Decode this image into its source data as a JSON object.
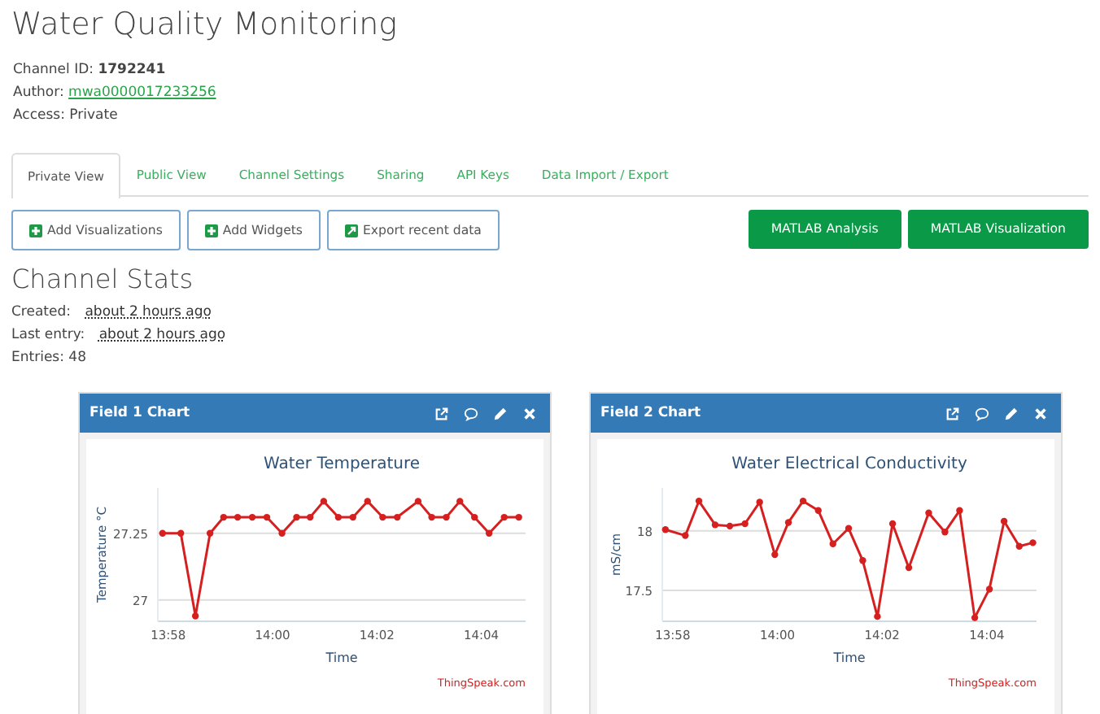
{
  "title": "Water Quality Monitoring",
  "channel_info": [
    {
      "label": "Channel ID:",
      "value": "1792241",
      "kind": "bold"
    },
    {
      "label": "Author:",
      "value": "mwa0000017233256",
      "kind": "link"
    },
    {
      "label": "Access:",
      "value": "Private",
      "kind": "plain"
    }
  ],
  "tabs": [
    {
      "label": "Private View",
      "selected": true
    },
    {
      "label": "Public View",
      "selected": false
    },
    {
      "label": "Channel Settings",
      "selected": false
    },
    {
      "label": "Sharing",
      "selected": false
    },
    {
      "label": "API Keys",
      "selected": false
    },
    {
      "label": "Data Import / Export",
      "selected": false
    }
  ],
  "action_buttons": [
    {
      "label": "Add Visualizations",
      "kind": "plus"
    },
    {
      "label": "Add Widgets",
      "kind": "plus"
    },
    {
      "label": "Export recent data",
      "kind": "export"
    }
  ],
  "matlab_buttons": [
    "MATLAB Analysis",
    "MATLAB Visualization"
  ],
  "stats": {
    "heading": "Channel Stats",
    "items": [
      {
        "label": "Created:",
        "value": "about 2 hours ago",
        "kind": "time"
      },
      {
        "label": "Last entry:",
        "value": "about 2 hours ago",
        "kind": "time"
      },
      {
        "label": "Entries:",
        "value": "48",
        "kind": "plain"
      }
    ]
  },
  "panels": [
    {
      "title": "Field 1 Chart",
      "credit": "ThingSpeak.com",
      "chart_data": {
        "type": "line",
        "title": "Water Temperature",
        "xlabel": "Time",
        "ylabel": "Temperature °C",
        "x": [
          837.89,
          838.24,
          838.52,
          838.8,
          839.06,
          839.33,
          839.61,
          839.89,
          840.18,
          840.46,
          840.72,
          840.98,
          841.26,
          841.54,
          841.82,
          842.11,
          842.39,
          842.79,
          843.05,
          843.33,
          843.59,
          843.87,
          844.15,
          844.44,
          844.72
        ],
        "series": [
          {
            "color": "#d62020",
            "marker": "circle",
            "values": [
              27.25,
              27.25,
              26.94,
              27.25,
              27.31,
              27.31,
              27.31,
              27.31,
              27.25,
              27.31,
              27.31,
              27.37,
              27.31,
              27.31,
              27.37,
              27.31,
              27.31,
              27.37,
              27.31,
              27.31,
              27.37,
              27.31,
              27.25,
              27.31,
              27.31
            ]
          }
        ],
        "xlim": [
          837.8,
          844.85
        ],
        "ylim": [
          26.92,
          27.42
        ],
        "xticks": [
          {
            "value": 838,
            "label": "13:58"
          },
          {
            "value": 840,
            "label": "14:00"
          },
          {
            "value": 842,
            "label": "14:02"
          },
          {
            "value": 844,
            "label": "14:04"
          }
        ],
        "yticks": [
          27,
          27.25
        ]
      }
    },
    {
      "title": "Field 2 Chart",
      "credit": "ThingSpeak.com",
      "chart_data": {
        "type": "line",
        "title": "Water Electrical Conductivity",
        "xlabel": "Time",
        "ylabel": "mS/cm",
        "x": [
          837.86,
          838.24,
          838.5,
          838.81,
          839.09,
          839.38,
          839.66,
          839.95,
          840.21,
          840.49,
          840.78,
          841.06,
          841.36,
          841.63,
          841.91,
          842.2,
          842.51,
          842.89,
          843.2,
          843.48,
          843.77,
          844.05,
          844.33,
          844.62,
          844.88
        ],
        "series": [
          {
            "color": "#d62020",
            "marker": "circle",
            "values": [
              18.01,
              17.96,
              18.25,
              18.05,
              18.04,
              18.06,
              18.24,
              17.8,
              18.07,
              18.25,
              18.17,
              17.89,
              18.02,
              17.75,
              17.28,
              18.06,
              17.69,
              18.15,
              17.99,
              18.17,
              17.27,
              17.51,
              18.08,
              17.87,
              17.9
            ]
          }
        ],
        "xlim": [
          837.8,
          844.95
        ],
        "ylim": [
          17.24,
          18.36
        ],
        "xticks": [
          {
            "value": 838,
            "label": "13:58"
          },
          {
            "value": 840,
            "label": "14:00"
          },
          {
            "value": 842,
            "label": "14:02"
          },
          {
            "value": 844,
            "label": "14:04"
          }
        ],
        "yticks": [
          17.5,
          18
        ]
      }
    }
  ]
}
